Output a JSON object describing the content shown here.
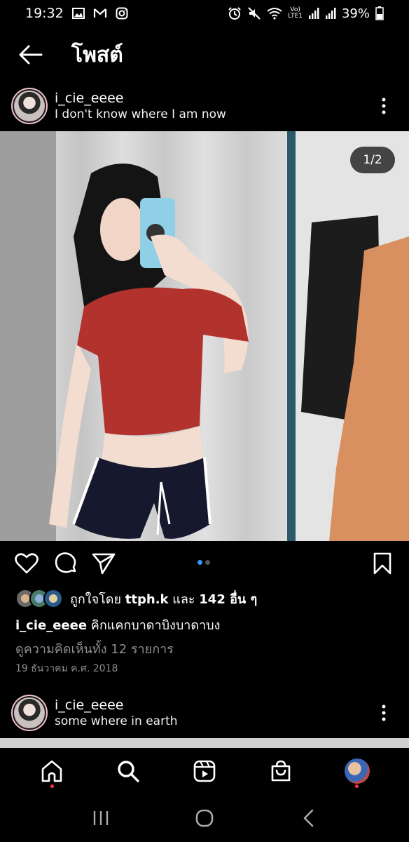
{
  "status_bar": {
    "time": "19:32",
    "network": "Vo)\nLTE1",
    "battery": "39%"
  },
  "header": {
    "title": "โพสต์"
  },
  "post": {
    "username": "i_cie_eeee",
    "location": "I don't know where I am now",
    "image_counter": "1/2",
    "likes_prefix": "ถูกใจโดย",
    "likes_user": "ttph.k",
    "likes_and": "และ",
    "likes_count": "142 อื่น ๆ",
    "caption_user": "i_cie_eeee",
    "caption_text": "คิกแคกบาดาบิงบาดาบง",
    "view_comments": "ดูความคิดเห็นทั้ง 12 รายการ",
    "date": "19 ธันวาคม ค.ศ. 2018"
  },
  "next_post": {
    "username": "i_cie_eeee",
    "location": "some where in earth"
  },
  "icons": {
    "back": "arrow-left-icon",
    "more": "more-vertical-icon",
    "like": "heart-icon",
    "comment": "comment-icon",
    "share": "send-icon",
    "save": "bookmark-icon",
    "home": "home-icon",
    "search": "search-icon",
    "reels": "reels-icon",
    "shop": "shop-icon"
  },
  "colors": {
    "background": "#000000",
    "active_dot": "#3897f0",
    "notification": "#ff3040"
  }
}
